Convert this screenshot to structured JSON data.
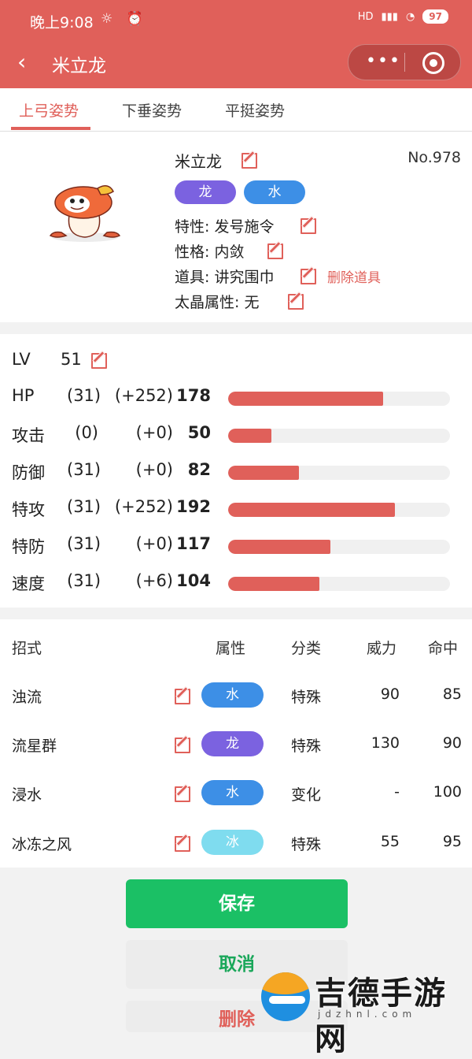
{
  "status_bar": {
    "time": "晚上9:08",
    "battery": "97",
    "net": "HD"
  },
  "nav": {
    "title": "米立龙"
  },
  "tabs": [
    "上弓姿势",
    "下垂姿势",
    "平挺姿势"
  ],
  "pokemon": {
    "name": "米立龙",
    "number": "No.978",
    "types": [
      {
        "label": "龙",
        "color": "#7b62e0"
      },
      {
        "label": "水",
        "color": "#3d8fe6"
      }
    ],
    "ability": "特性: 发号施令",
    "nature": "性格: 内敛",
    "item": "道具: 讲究围巾",
    "remove_item": "删除道具",
    "tera": "太晶属性: 无"
  },
  "level": {
    "label": "LV",
    "value": "51"
  },
  "stats": [
    {
      "name": "HP",
      "iv": "(31)",
      "ev": "(+252)",
      "total": "178",
      "fill": 0.7
    },
    {
      "name": "攻击",
      "iv": "(0)",
      "ev": "(+0)",
      "total": "50",
      "fill": 0.195
    },
    {
      "name": "防御",
      "iv": "(31)",
      "ev": "(+0)",
      "total": "82",
      "fill": 0.32
    },
    {
      "name": "特攻",
      "iv": "(31)",
      "ev": "(+252)",
      "total": "192",
      "fill": 0.75
    },
    {
      "name": "特防",
      "iv": "(31)",
      "ev": "(+0)",
      "total": "117",
      "fill": 0.46
    },
    {
      "name": "速度",
      "iv": "(31)",
      "ev": "(+6)",
      "total": "104",
      "fill": 0.41
    }
  ],
  "moves_header": {
    "move": "招式",
    "type": "属性",
    "category": "分类",
    "power": "威力",
    "accuracy": "命中"
  },
  "moves": [
    {
      "name": "浊流",
      "type": "水",
      "color": "#3d8fe6",
      "category": "特殊",
      "power": "90",
      "accuracy": "85"
    },
    {
      "name": "流星群",
      "type": "龙",
      "color": "#7b62e0",
      "category": "特殊",
      "power": "130",
      "accuracy": "90"
    },
    {
      "name": "浸水",
      "type": "水",
      "color": "#3d8fe6",
      "category": "变化",
      "power": "-",
      "accuracy": "100"
    },
    {
      "name": "冰冻之风",
      "type": "冰",
      "color": "#7fdcef",
      "category": "特殊",
      "power": "55",
      "accuracy": "95"
    }
  ],
  "buttons": {
    "save": "保存",
    "cancel": "取消",
    "delete": "删除"
  },
  "watermark": {
    "text": "吉德手游网",
    "sub": "jdzhnl.com"
  }
}
